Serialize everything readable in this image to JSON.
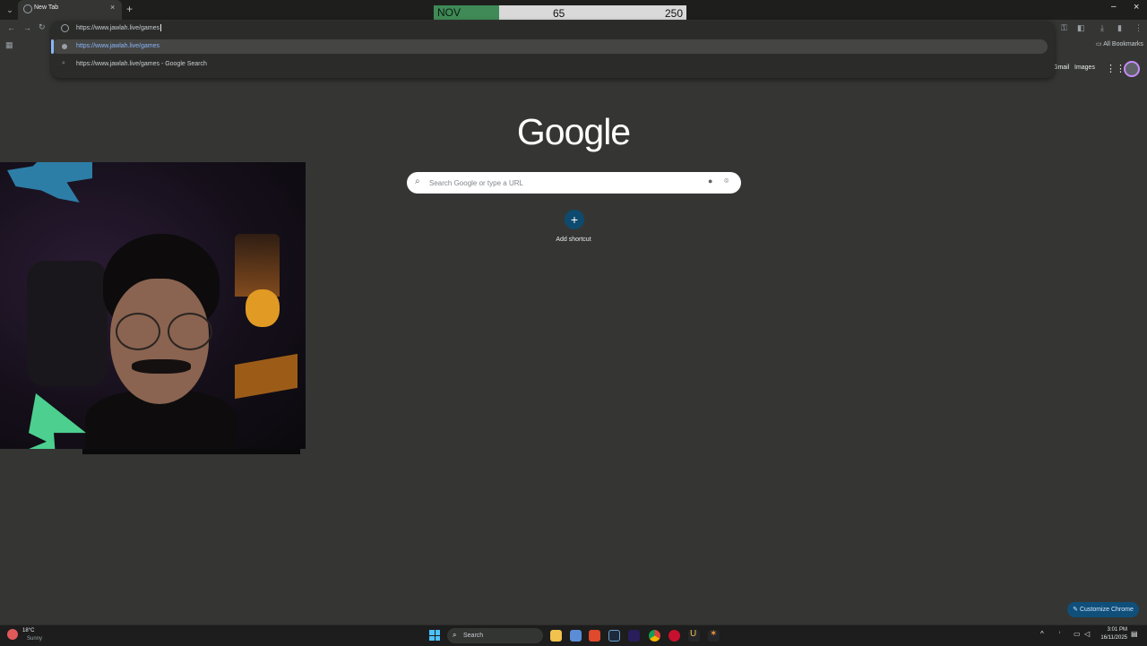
{
  "browser": {
    "tab_title": "New Tab",
    "tab_close": "×",
    "new_tab": "+",
    "window_min": "–",
    "window_close": "×",
    "tab_search_glyph": "⌄"
  },
  "overlay_counter": {
    "month": "NOV",
    "count": "65",
    "goal": "250"
  },
  "toolbar": {
    "back": "←",
    "forward": "→",
    "reload": "↻"
  },
  "omnibox": {
    "typed_text": "https://www.jawlah.live/games",
    "suggestions": [
      {
        "text": "https://www.jawlah.live/games"
      },
      {
        "text": "https://www.jawlah.live/games - Google Search"
      }
    ]
  },
  "bookmarks": {
    "all_bookmarks": "All Bookmarks"
  },
  "ntp": {
    "gmail": "Gmail",
    "images": "Images",
    "logo": "Google",
    "search_placeholder": "Search Google or type a URL",
    "add_shortcut_label": "Add shortcut",
    "add_shortcut_glyph": "+",
    "customize_label": "Customize Chrome"
  },
  "taskbar": {
    "weather_temp": "18°C",
    "weather_desc": "Sunny",
    "search_label": "Search",
    "time": "3:01 PM",
    "date": "16/11/2025"
  },
  "icons": {
    "mic": "🎤",
    "lens": "⌾",
    "search": "⌕",
    "apps": "⋮⋮⋮",
    "menu": "⋮"
  },
  "colors": {
    "page_bg": "#353634",
    "counter_green": "#3f8a56",
    "accent_blue": "#8ab4f8",
    "customize_bg": "#0f4f7a"
  }
}
